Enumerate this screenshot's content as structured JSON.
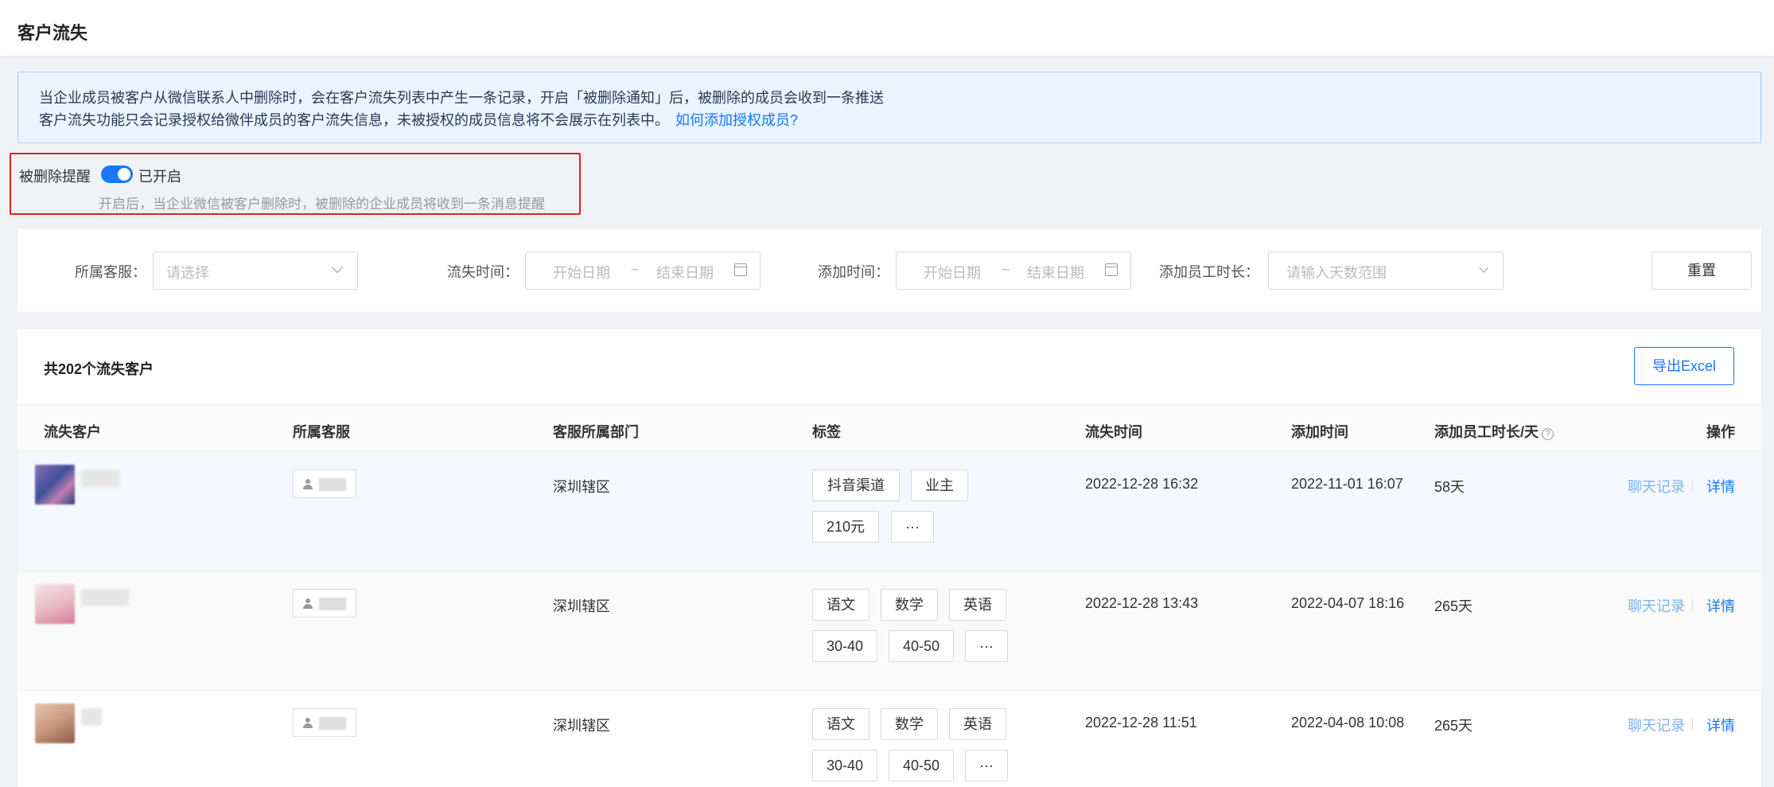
{
  "page": {
    "title": "客户流失"
  },
  "notice": {
    "line1": "当企业成员被客户从微信联系人中删除时，会在客户流失列表中产生一条记录，开启「被删除通知」后，被删除的成员会收到一条推送",
    "line2": "客户流失功能只会记录授权给微伴成员的客户流失信息，未被授权的成员信息将不会展示在列表中。",
    "link": "如何添加授权成员?"
  },
  "remind": {
    "label": "被删除提醒",
    "enabled": true,
    "status": "已开启",
    "desc": "开启后，当企业微信被客户删除时，被删除的企业成员将收到一条消息提醒"
  },
  "filters": {
    "cs_label": "所属客服：",
    "cs_placeholder": "请选择",
    "lost_label": "流失时间：",
    "lost_start": "开始日期",
    "lost_end": "结束日期",
    "add_label": "添加时间：",
    "add_start": "开始日期",
    "add_end": "结束日期",
    "tilde": "~",
    "days_label": "添加员工时长：",
    "days_placeholder": "请输入天数范围",
    "reset": "重置"
  },
  "table": {
    "count_title": "共202个流失客户",
    "export": "导出Excel",
    "headers": {
      "customer": "流失客户",
      "cs": "所属客服",
      "dept": "客服所属部门",
      "tags": "标签",
      "lost_time": "流失时间",
      "add_time": "添加时间",
      "duration": "添加员工时长/天",
      "help": "?",
      "ops": "操作"
    },
    "rows": [
      {
        "dept": "深圳辖区",
        "tags": [
          "抖音渠道",
          "业主",
          "210元",
          "···"
        ],
        "lost_time": "2022-12-28 16:32",
        "add_time": "2022-11-01 16:07",
        "duration": "58天",
        "chat": "聊天记录",
        "detail": "详情",
        "avatar_color": "#6b5aa0"
      },
      {
        "dept": "深圳辖区",
        "tags": [
          "语文",
          "数学",
          "英语",
          "30-40",
          "40-50",
          "···"
        ],
        "lost_time": "2022-12-28 13:43",
        "add_time": "2022-04-07 18:16",
        "duration": "265天",
        "chat": "聊天记录",
        "detail": "详情",
        "avatar_color": "#e8b7c4"
      },
      {
        "dept": "深圳辖区",
        "tags": [
          "语文",
          "数学",
          "英语",
          "30-40",
          "40-50",
          "···"
        ],
        "lost_time": "2022-12-28 11:51",
        "add_time": "2022-04-08 10:08",
        "duration": "265天",
        "chat": "聊天记录",
        "detail": "详情",
        "avatar_color": "#c99a7e"
      }
    ]
  },
  "colors": {
    "primary": "#1677ff",
    "highlight_border": "#e02020",
    "notice_bg": "#eaf4ff"
  }
}
